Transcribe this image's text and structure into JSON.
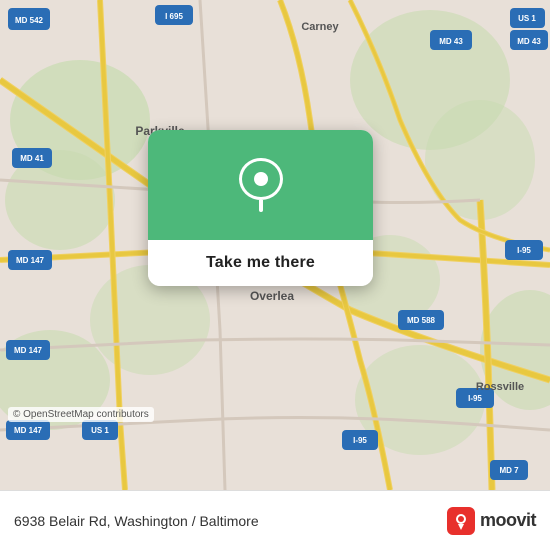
{
  "map": {
    "background_color": "#e8e0d8",
    "popup": {
      "button_label": "Take me there",
      "pin_color": "#4db87a"
    },
    "osm_credit": "© OpenStreetMap contributors"
  },
  "footer": {
    "address": "6938 Belair Rd, Washington / Baltimore",
    "logo_text": "moovit",
    "logo_icon": "m"
  }
}
